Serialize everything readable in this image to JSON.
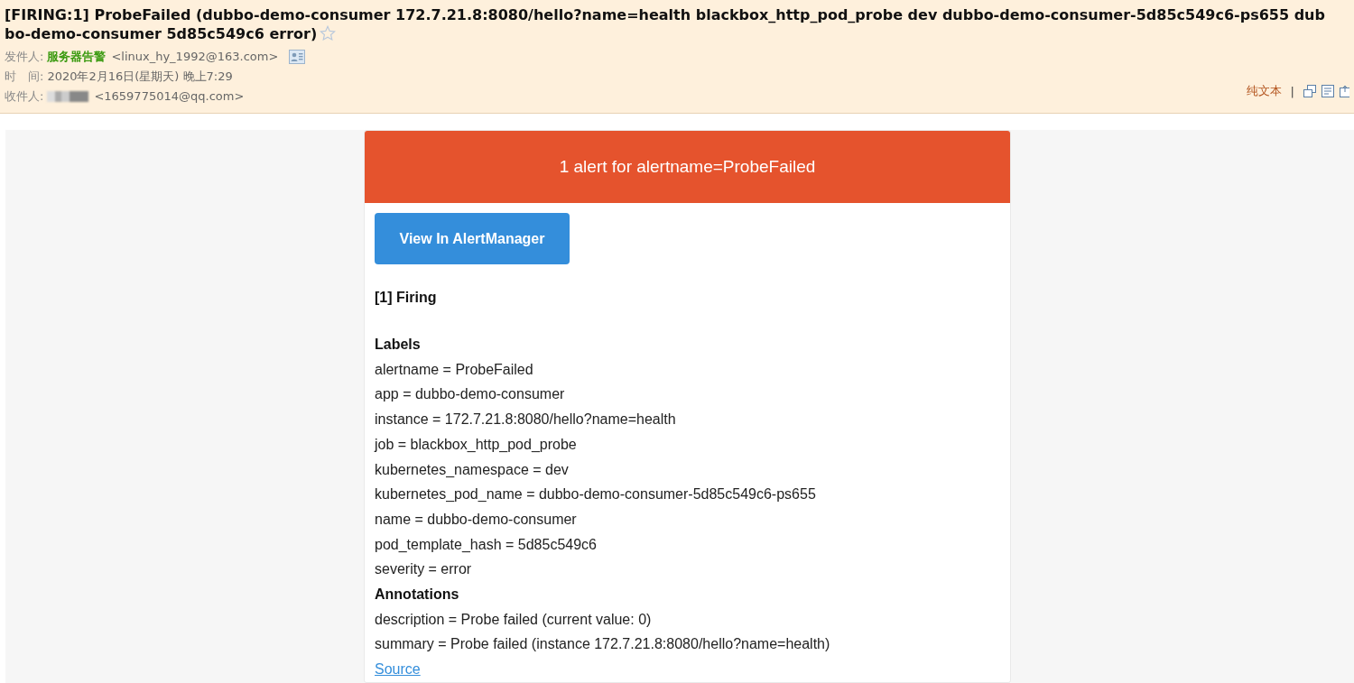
{
  "email": {
    "subject": "[FIRING:1] ProbeFailed (dubbo-demo-consumer 172.7.21.8:8080/hello?name=health blackbox_http_pod_probe dev dubbo-demo-consumer-5d85c549c6-ps655 dubbo-demo-consumer 5d85c549c6 error)",
    "starred": false,
    "from": {
      "label": "发件人:",
      "name": "服务器告警",
      "address": "<linux_hy_1992@163.com>"
    },
    "time": {
      "label": "时　间:",
      "value": "2020年2月16日(星期天) 晚上7:29"
    },
    "to": {
      "label": "收件人:",
      "address": "<1659775014@qq.com>"
    },
    "plain_text_link": "纯文本",
    "separator": "|"
  },
  "alert": {
    "header": "1 alert for alertname=ProbeFailed",
    "button": "View In AlertManager",
    "firing_title": "[1] Firing",
    "sections": [
      {
        "heading": "Labels",
        "items": [
          "alertname = ProbeFailed",
          "app = dubbo-demo-consumer",
          "instance = 172.7.21.8:8080/hello?name=health",
          "job = blackbox_http_pod_probe",
          "kubernetes_namespace = dev",
          "kubernetes_pod_name = dubbo-demo-consumer-5d85c549c6-ps655",
          "name = dubbo-demo-consumer",
          "pod_template_hash = 5d85c549c6",
          "severity = error"
        ]
      },
      {
        "heading": "Annotations",
        "items": [
          "description = Probe failed (current value: 0)",
          "summary = Probe failed (instance 172.7.21.8:8080/hello?name=health)"
        ]
      }
    ],
    "source_link": "Source"
  }
}
